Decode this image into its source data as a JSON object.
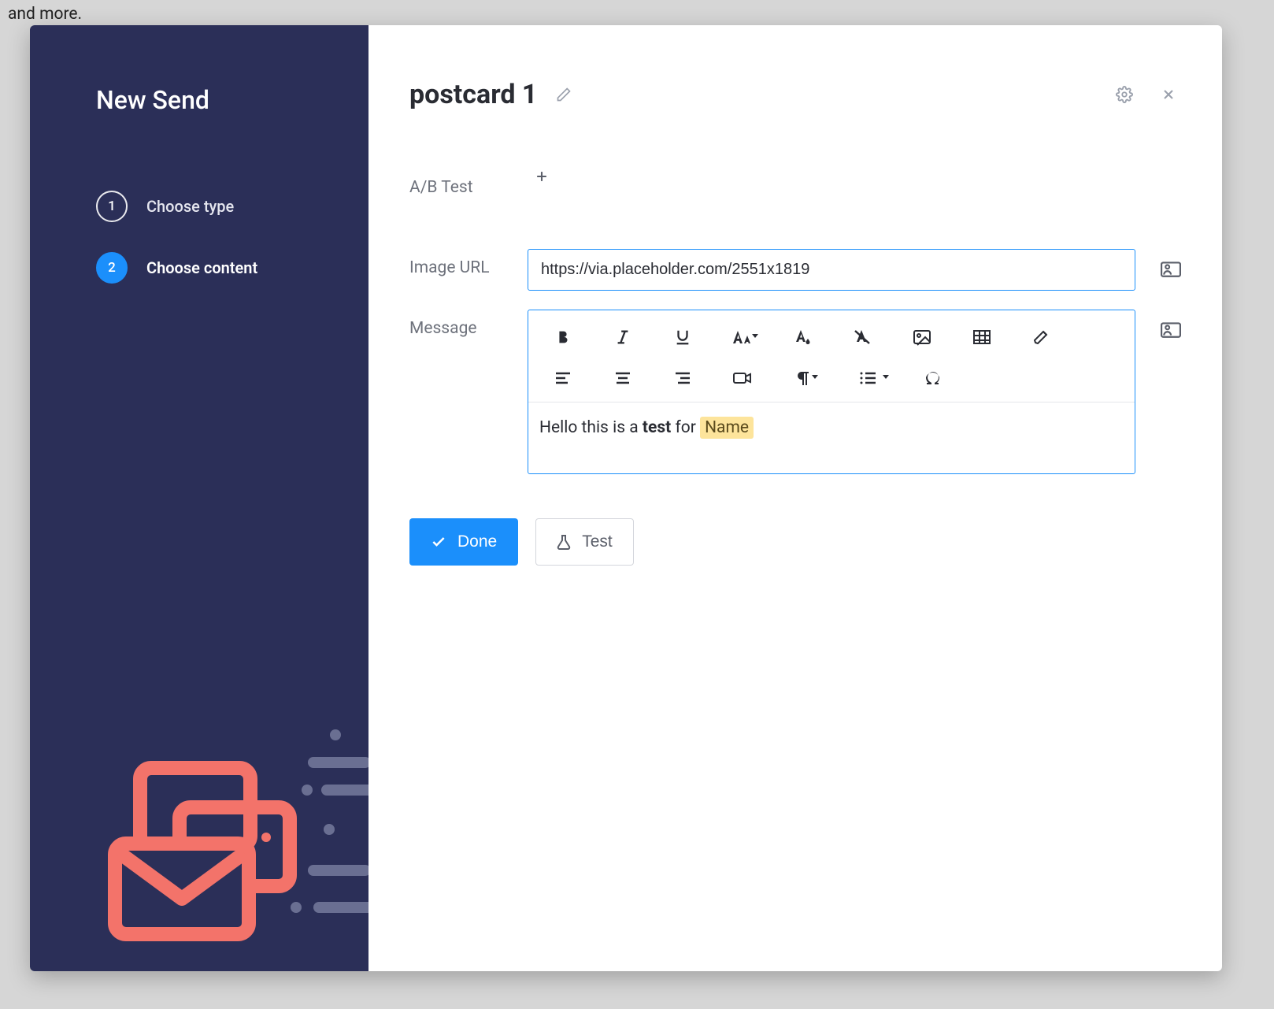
{
  "background_text": "and more.",
  "sidebar": {
    "title": "New Send",
    "steps": [
      {
        "num": "1",
        "label": "Choose type",
        "active": false
      },
      {
        "num": "2",
        "label": "Choose content",
        "active": true
      }
    ]
  },
  "header": {
    "title": "postcard 1"
  },
  "form": {
    "abtest_label": "A/B Test",
    "image_url_label": "Image URL",
    "image_url_value": "https://via.placeholder.com/2551x1819",
    "message_label": "Message",
    "message_text_prefix": "Hello this is a ",
    "message_text_bold": "test",
    "message_text_mid": " for  ",
    "message_tag": "Name"
  },
  "actions": {
    "done": "Done",
    "test": "Test"
  }
}
